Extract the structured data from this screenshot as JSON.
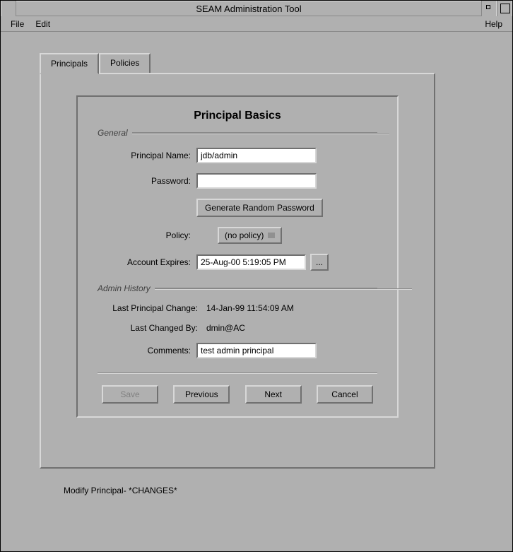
{
  "window": {
    "title": "SEAM Administration Tool"
  },
  "menubar": {
    "file": "File",
    "edit": "Edit",
    "help": "Help"
  },
  "tabs": {
    "principals": "Principals",
    "policies": "Policies"
  },
  "panel": {
    "title": "Principal Basics"
  },
  "groups": {
    "general": "General",
    "admin_history": "Admin History"
  },
  "labels": {
    "principal_name": "Principal Name:",
    "password": "Password:",
    "generate_random": "Generate Random Password",
    "policy": "Policy:",
    "policy_value": "(no policy)",
    "account_expires": "Account Expires:",
    "date_picker": "...",
    "last_principal_change": "Last Principal Change:",
    "last_changed_by": "Last Changed By:",
    "comments": "Comments:"
  },
  "values": {
    "principal_name": "jdb/admin",
    "password": "",
    "account_expires": "25-Aug-00 5:19:05 PM",
    "last_principal_change": "14-Jan-99 11:54:09 AM",
    "last_changed_by": "dmin@AC",
    "comments": "test admin principal"
  },
  "buttons": {
    "save": "Save",
    "previous": "Previous",
    "next": "Next",
    "cancel": "Cancel"
  },
  "status": "Modify Principal- *CHANGES*"
}
